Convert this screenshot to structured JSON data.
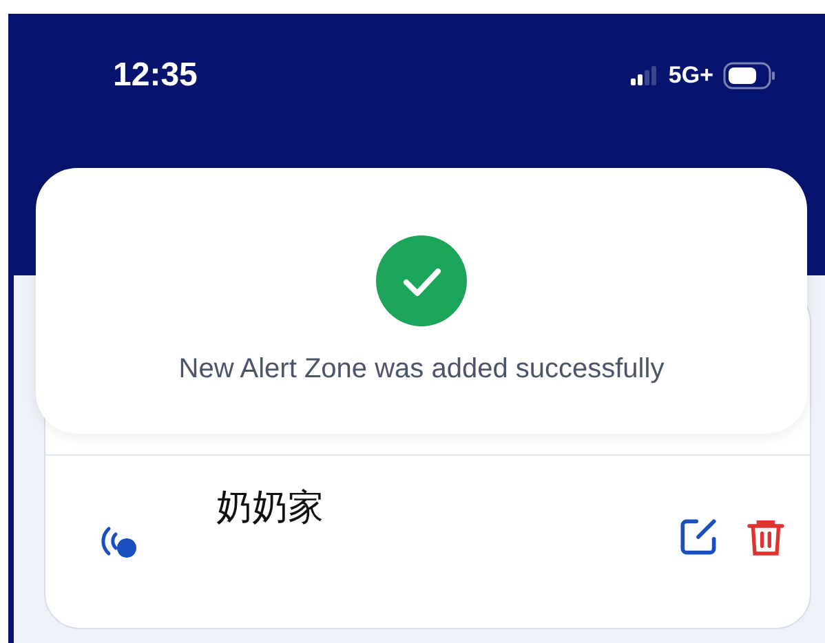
{
  "status_bar": {
    "time": "12:35",
    "network": "5G+"
  },
  "toast": {
    "message": "New Alert Zone was added successfully"
  },
  "zones": [
    {
      "name": "奶奶家"
    }
  ]
}
